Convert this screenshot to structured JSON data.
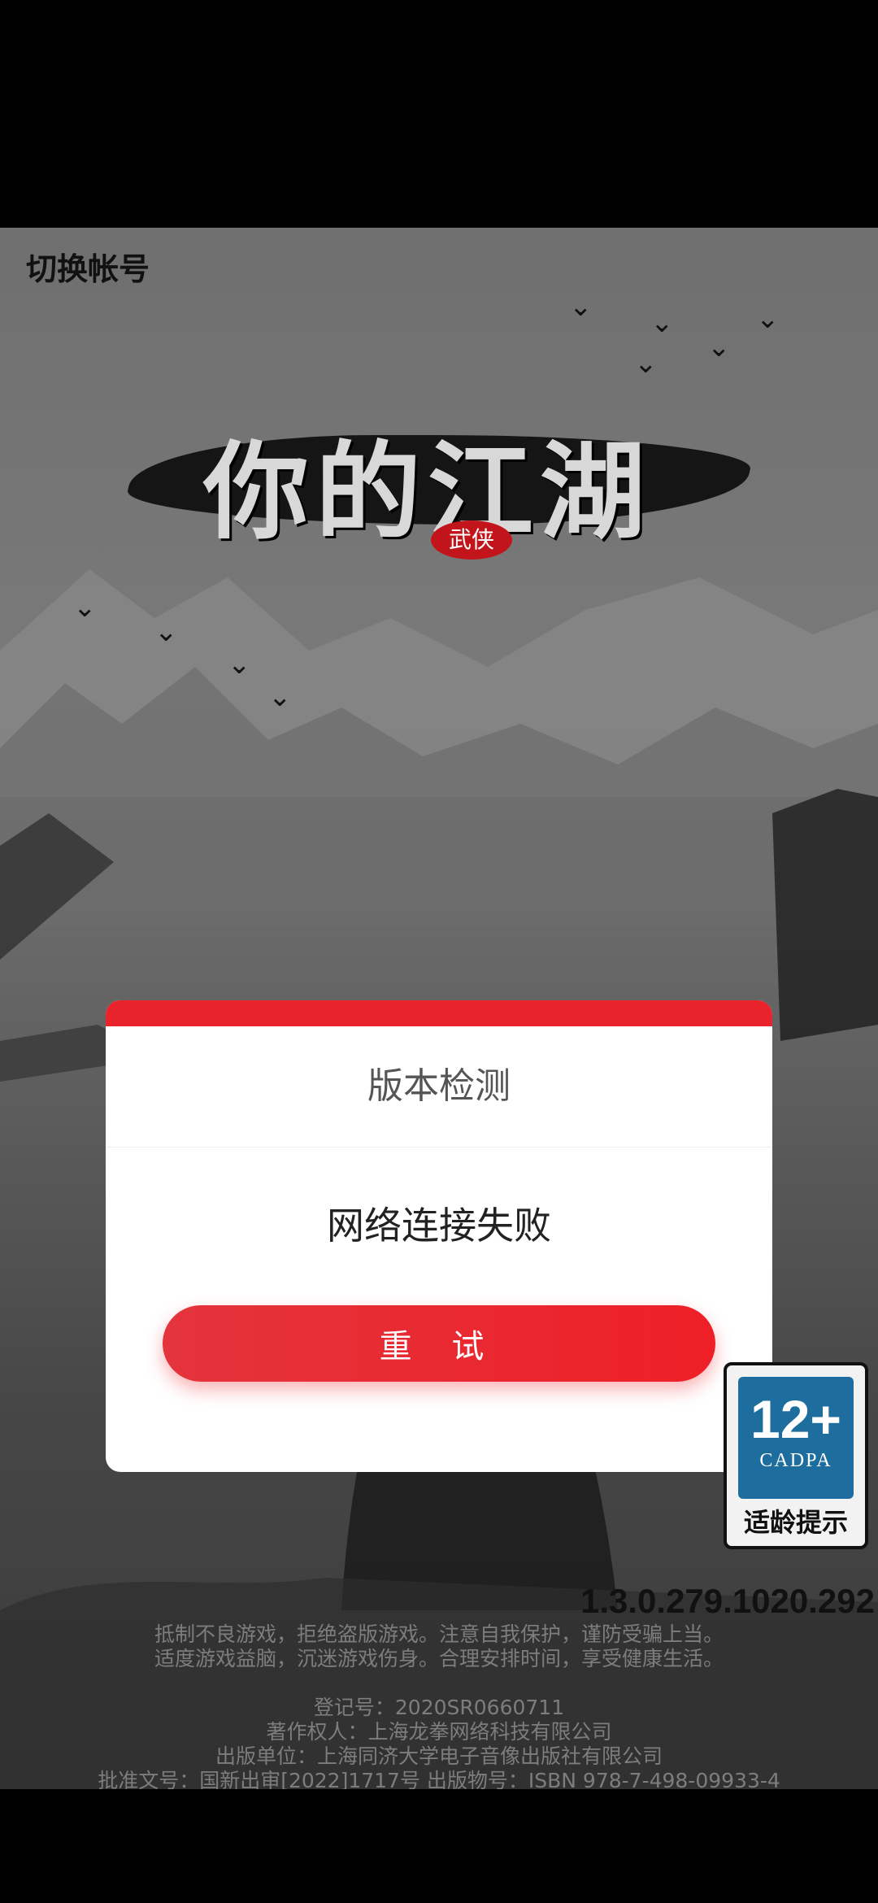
{
  "top_bar": {
    "switch_account_label": "切换帐号"
  },
  "logo": {
    "title": "你的江湖",
    "seal": "武侠"
  },
  "dialog": {
    "title": "版本检测",
    "message": "网络连接失败",
    "retry_label": "重 试"
  },
  "age_rating": {
    "rating": "12+",
    "org": "CADPA",
    "tip": "适龄提示"
  },
  "version": "1.3.0.279.1020.292",
  "footer": {
    "health_notice_1": "抵制不良游戏，拒绝盗版游戏。注意自我保护，谨防受骗上当。",
    "health_notice_2": "适度游戏益脑，沉迷游戏伤身。合理安排时间，享受健康生活。",
    "registration": "登记号：2020SR0660711",
    "copyright_owner": "著作权人：上海龙拳网络科技有限公司",
    "publisher": "出版单位：上海同济大学电子音像出版社有限公司",
    "approval": "批准文号：国新出审[2022]1717号  出版物号：ISBN 978-7-498-09933-4"
  },
  "colors": {
    "accent": "#e8232b",
    "badge_blue": "#1d6e9e"
  }
}
